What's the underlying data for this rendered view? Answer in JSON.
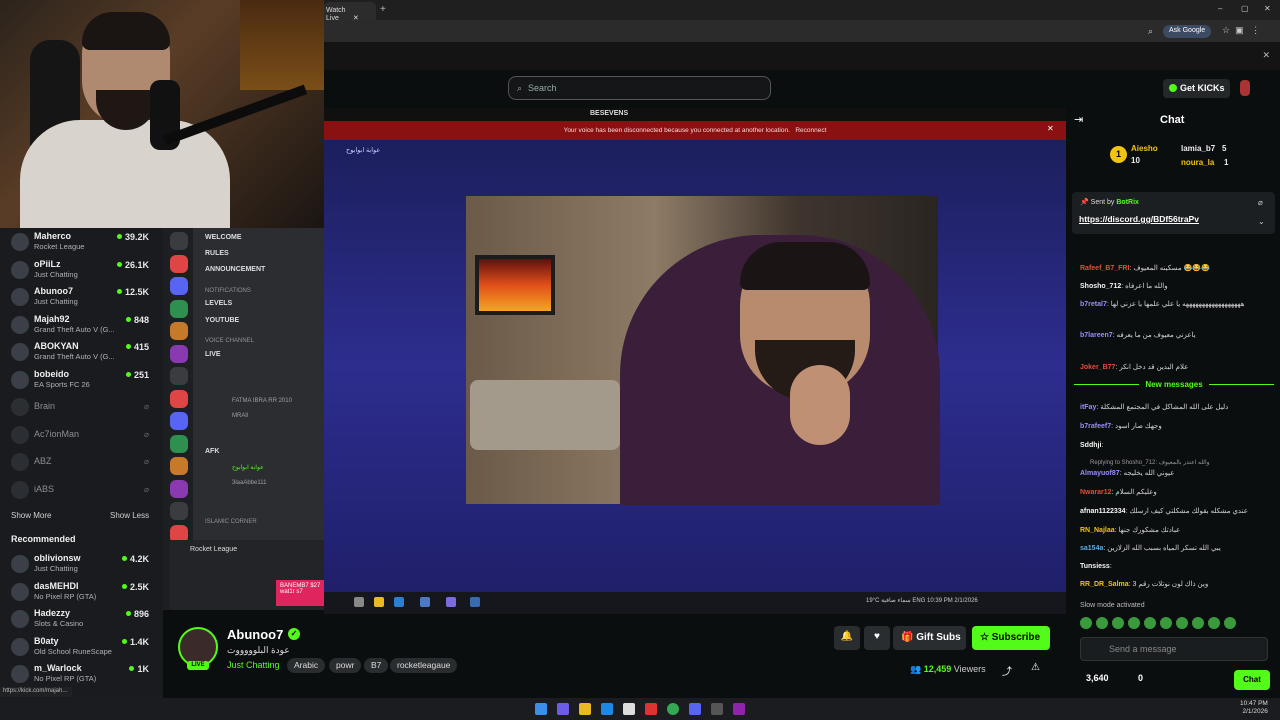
{
  "browser": {
    "tab_title": "Watch Live",
    "ask_google": "Ask Google",
    "win_min": "–",
    "win_max": "▢",
    "win_close": "✕",
    "new_tab": "+"
  },
  "header": {
    "search_placeholder": "Search",
    "get_kicks": "Get KICKs"
  },
  "sidebar": {
    "following": [
      {
        "name": "Maherco",
        "category": "Rocket League",
        "viewers": "39.2K"
      },
      {
        "name": "oPiiLz",
        "category": "Just Chatting",
        "viewers": "26.1K"
      },
      {
        "name": "Abunoo7",
        "category": "Just Chatting",
        "viewers": "12.5K"
      },
      {
        "name": "Majah92",
        "category": "Grand Theft Auto V (G...",
        "viewers": "848"
      },
      {
        "name": "ABOKYAN",
        "category": "Grand Theft Auto V (G...",
        "viewers": "415"
      },
      {
        "name": "bobeido",
        "category": "EA Sports FC 26",
        "viewers": "251"
      }
    ],
    "offline": [
      "Brain",
      "Ac7ionMan",
      "ABZ",
      "iABS"
    ],
    "show_more": "Show More",
    "show_less": "Show Less",
    "recommended_title": "Recommended",
    "recommended": [
      {
        "name": "oblivionsw",
        "category": "Just Chatting",
        "viewers": "4.2K"
      },
      {
        "name": "dasMEHDI",
        "category": "No Pixel RP (GTA)",
        "viewers": "2.5K"
      },
      {
        "name": "Hadezzy",
        "category": "Slots & Casino",
        "viewers": "896"
      },
      {
        "name": "B0aty",
        "category": "Old School RuneScape",
        "viewers": "1.4K"
      },
      {
        "name": "m_Warlock",
        "category": "No Pixel RP (GTA)",
        "viewers": "1K"
      }
    ],
    "status_url": "https://kick.com/majah..."
  },
  "discord": {
    "channels": [
      "WELCOME",
      "RULES",
      "ANNOUNCEMENT",
      "LEVELS",
      "YOUTUBE",
      "LIVE",
      "AFK"
    ],
    "sections": [
      "Notifications",
      "VOICE CHANNEL",
      "ISLAMIC CORNER"
    ],
    "users": [
      "FATMA IBRA RR 2010",
      "MRAll",
      "3laaAbbe111",
      "عوابة ابوابوح"
    ],
    "bottom_label": "Rocket League",
    "badge_line1": "BANEMB7 $27",
    "badge_line2": "wat1r s7"
  },
  "stream": {
    "window_title": "BESEVENS",
    "disconnect_msg": "Your voice has been disconnected because you connected at another location.",
    "reconnect": "Reconnect",
    "voice_label": "عوابة ابوابوح",
    "taskbar_info": "19°C  سماء صافية  ENG  10:39 PM 2/1/2026"
  },
  "chat": {
    "title": "Chat",
    "gifters": [
      {
        "name": "Aiesho",
        "count": "10"
      },
      {
        "name": "lamia_b7",
        "count": "5"
      },
      {
        "name": "noura_la",
        "count": "1"
      }
    ],
    "pinned_by": "Sent by",
    "pinned_user": "BotRix",
    "pinned_link": "https://discord.gg/BDf56traPv",
    "messages": [
      {
        "user": "Rafeef_B7_FRI",
        "color": "#e74c3c",
        "text": ": مسكينه المعيوف 😂😂😂"
      },
      {
        "user": "Shosho_712",
        "color": "#f5f5f5",
        "text": ": والله ما اعرفاه"
      },
      {
        "user": "b7retal7",
        "color": "#9b8cff",
        "text": ": ههههههههههههههههههه يا علي علمها يا عزني لها"
      },
      {
        "user": "b7lareen7",
        "color": "#9b8cff",
        "text": ": ياعزني معيوف من ما يعرفه"
      },
      {
        "user": "Joker_B77",
        "color": "#e74c3c",
        "text": ": علام البدين قد دخل انكر"
      },
      {
        "user": "itFay",
        "color": "#9b8cff",
        "text": ": دليل على الله المشاكل في المجتمع المشكلة"
      },
      {
        "user": "b7rafeef7",
        "color": "#9b8cff",
        "text": ": وجهك صار اسود"
      },
      {
        "user": "Sddhji",
        "color": "#f5f5f5",
        "text": ":"
      },
      {
        "user": "Almayuof87",
        "color": "#9b8cff",
        "text": ": عيوني الله يخليجه"
      },
      {
        "user": "Nwarar12",
        "color": "#e74c3c",
        "text": ": وعليكم السلام"
      },
      {
        "user": "afnan1122334",
        "color": "#f5f5f5",
        "text": ": عندي مشكله بقولك مشكلتي كيف ارسلك"
      },
      {
        "user": "RN_Najlaa",
        "color": "#f1c40f",
        "text": ": عبادتك مشكورك جنها"
      },
      {
        "user": "sa154a",
        "color": "#5dade2",
        "text": ": يبي الله تسكر المياه بسبب الله الزلازين"
      },
      {
        "user": "Tunsiess",
        "color": "#f5f5f5",
        "text": ":"
      },
      {
        "user": "RR_DR_Salma",
        "color": "#f1c40f",
        "text": ": وين ذاك لون نوتلات رقم 3"
      }
    ],
    "new_messages": "New messages",
    "replying": "Replying to Shosho_712: والله اعتذر بالمعيوف",
    "slow_mode": "Slow mode activated",
    "input_placeholder": "Send a message",
    "kicks_count": "3,640",
    "sub_count": "0",
    "send_label": "Chat"
  },
  "channel": {
    "name": "Abunoo7",
    "live_label": "LIVE",
    "title": "عودة البلوووووت",
    "category": "Just Chatting",
    "tags": [
      "Arabic",
      "powr",
      "B7",
      "rocketleagaue"
    ],
    "gift_subs": "Gift Subs",
    "subscribe": "Subscribe",
    "viewers": "12,459",
    "viewers_label": "Viewers"
  },
  "os": {
    "time": "10:47 PM",
    "date": "2/1/2026"
  },
  "colors": {
    "kick_green": "#53fc18",
    "bg": "#0b0e0f",
    "disconnect_red": "#8a1111"
  }
}
